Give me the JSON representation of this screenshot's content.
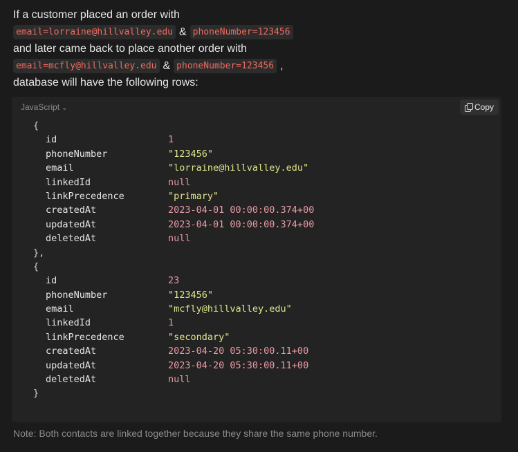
{
  "prose": {
    "line1": "If a customer placed an order with",
    "order1": {
      "email_code": "email=lorraine@hillvalley.edu",
      "amp": "&",
      "phone_code": "phoneNumber=123456"
    },
    "line3": "and later came back to place another order with",
    "order2": {
      "email_code": "email=mcfly@hillvalley.edu",
      "amp": "&",
      "phone_code": "phoneNumber=123456",
      "trailing": ","
    },
    "line5": "database will have the following rows:"
  },
  "code_block": {
    "language": "JavaScript",
    "copy_label": "Copy",
    "open_brace": "{",
    "mid_brace": "},",
    "close_brace": "}",
    "rows": [
      [
        {
          "key": "id",
          "value": "1"
        },
        {
          "key": "phoneNumber",
          "value": "\"123456\""
        },
        {
          "key": "email",
          "value": "\"lorraine@hillvalley.edu\""
        },
        {
          "key": "linkedId",
          "value": "null"
        },
        {
          "key": "linkPrecedence",
          "value": "\"primary\""
        },
        {
          "key": "createdAt",
          "value": "2023-04-01 00:00:00.374+00"
        },
        {
          "key": "updatedAt",
          "value": "2023-04-01 00:00:00.374+00"
        },
        {
          "key": "deletedAt",
          "value": "null"
        }
      ],
      [
        {
          "key": "id",
          "value": "23"
        },
        {
          "key": "phoneNumber",
          "value": "\"123456\""
        },
        {
          "key": "email",
          "value": "\"mcfly@hillvalley.edu\""
        },
        {
          "key": "linkedId",
          "value": "1"
        },
        {
          "key": "linkPrecedence",
          "value": "\"secondary\""
        },
        {
          "key": "createdAt",
          "value": "2023-04-20 05:30:00.11+00"
        },
        {
          "key": "updatedAt",
          "value": "2023-04-20 05:30:00.11+00"
        },
        {
          "key": "deletedAt",
          "value": "null"
        }
      ]
    ]
  },
  "note": "Note: Both contacts are linked together because they share the same phone number."
}
